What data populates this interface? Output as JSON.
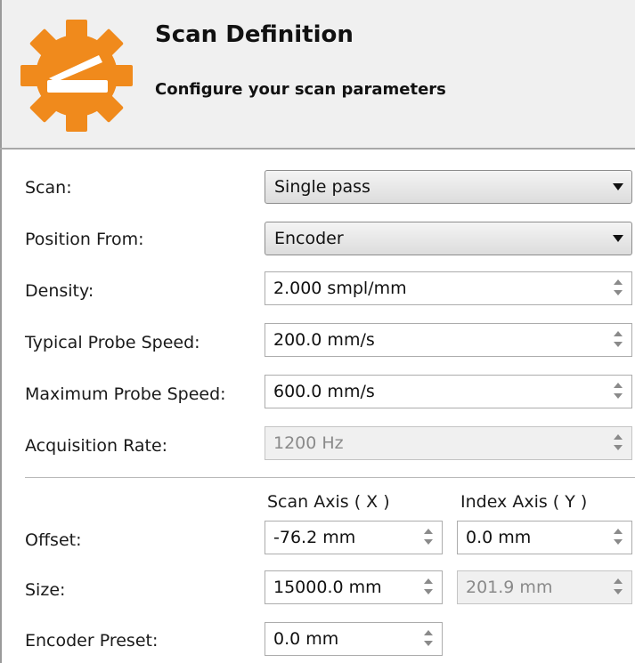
{
  "header": {
    "title": "Scan Definition",
    "subtitle": "Configure your scan parameters",
    "icon": "gear-scanner-icon",
    "accent_color": "#f08a1c"
  },
  "settings": {
    "scan": {
      "label": "Scan:",
      "value": "Single pass"
    },
    "position_from": {
      "label": "Position From:",
      "value": "Encoder"
    },
    "density": {
      "label": "Density:",
      "value": "2.000 smpl/mm"
    },
    "typical_probe_speed": {
      "label": "Typical Probe Speed:",
      "value": "200.0 mm/s"
    },
    "maximum_probe_speed": {
      "label": "Maximum Probe Speed:",
      "value": "600.0 mm/s"
    },
    "acquisition_rate": {
      "label": "Acquisition Rate:",
      "value": "1200 Hz",
      "disabled": true
    }
  },
  "axes": {
    "scan_axis_header": "Scan Axis ( X )",
    "index_axis_header": "Index Axis ( Y )",
    "offset": {
      "label": "Offset:",
      "scan_value": "-76.2 mm",
      "index_value": "0.0 mm"
    },
    "size": {
      "label": "Size:",
      "scan_value": "15000.0 mm",
      "index_value": "201.9 mm",
      "index_disabled": true
    },
    "encoder_preset": {
      "label": "Encoder Preset:",
      "scan_value": "0.0 mm"
    }
  }
}
